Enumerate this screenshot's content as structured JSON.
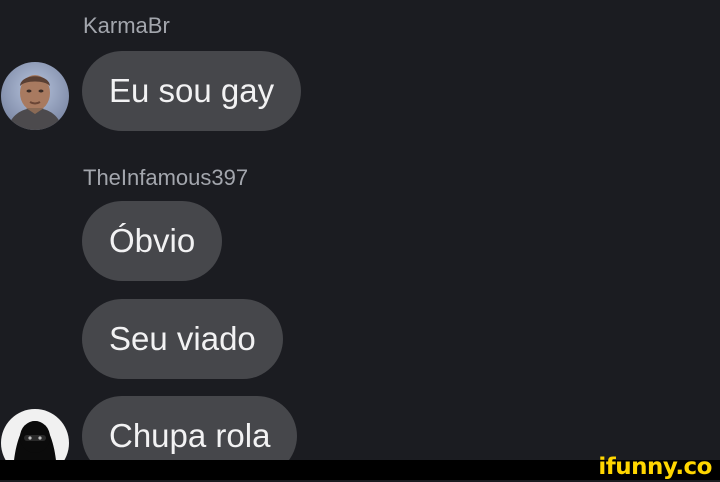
{
  "messages": [
    {
      "sender": "KarmaBr",
      "texts": [
        "Eu sou gay"
      ],
      "avatar": "gta-character-avatar"
    },
    {
      "sender": "TheInfamous397",
      "texts": [
        "Óbvio",
        "Seu viado",
        "Chupa rola"
      ],
      "avatar": "balaclava-avatar"
    }
  ],
  "watermark": "ifunny.co",
  "colors": {
    "background": "#1b1c21",
    "bubble": "#46474b",
    "bubble_text": "#f2f2f3",
    "sender_text": "#a3a6ad",
    "watermark": "#ffd600"
  }
}
